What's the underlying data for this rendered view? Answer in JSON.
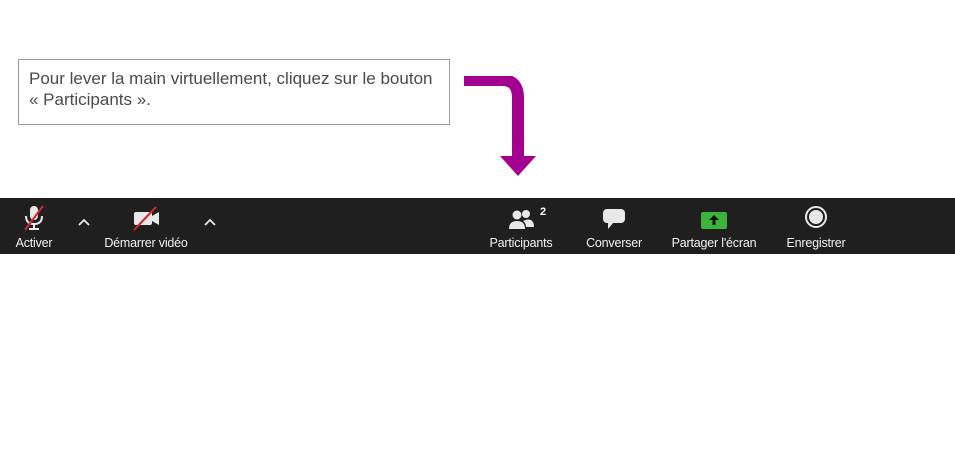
{
  "callout": {
    "text": "Pour lever la main virtuellement, cliquez sur le bouton « Participants »."
  },
  "toolbar": {
    "mute_label": "Activer",
    "video_label": "Démarrer vidéo",
    "participants_label": "Participants",
    "participants_count": "2",
    "chat_label": "Converser",
    "share_label": "Partager l'écran",
    "record_label": "Enregistrer"
  },
  "colors": {
    "arrow": "#a3008f",
    "toolbar_bg": "#1f1f1f",
    "share_green": "#3cb43c",
    "muted_red": "#d0262c"
  },
  "icons": {
    "mute": "microphone-muted-icon",
    "video": "camera-off-icon",
    "participants": "people-icon",
    "chat": "chat-bubble-icon",
    "share": "share-screen-icon",
    "record": "record-icon"
  }
}
